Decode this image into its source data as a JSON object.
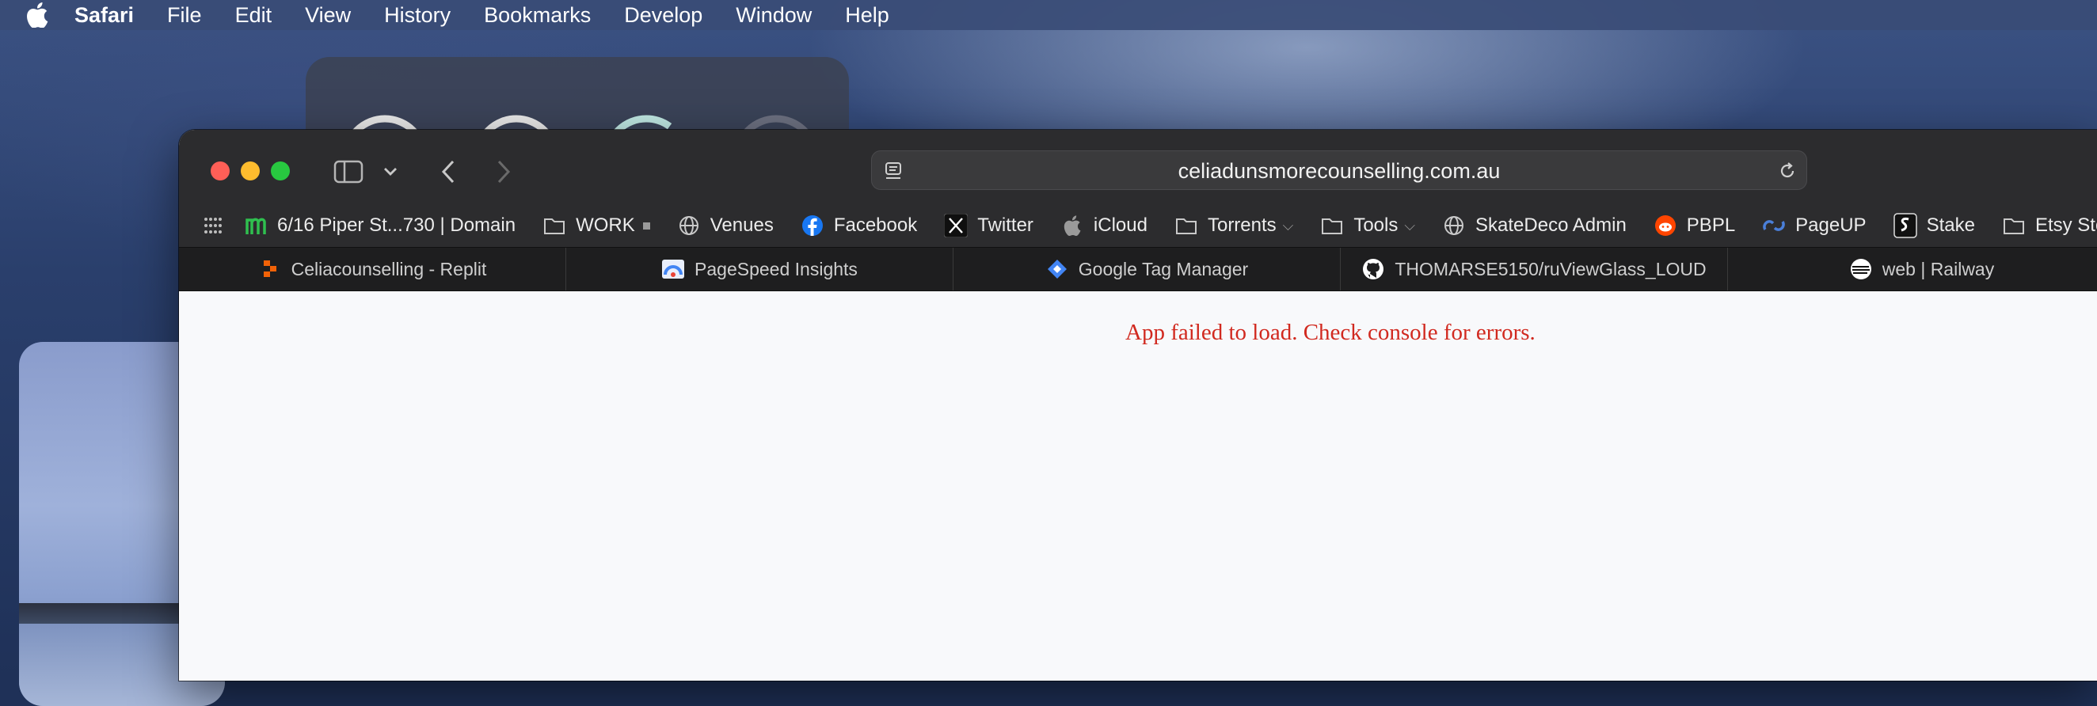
{
  "menubar": {
    "app_name": "Safari",
    "items": [
      "File",
      "Edit",
      "View",
      "History",
      "Bookmarks",
      "Develop",
      "Window",
      "Help"
    ]
  },
  "address_bar": {
    "url": "celiadunsmorecounselling.com.au"
  },
  "bookmarks": [
    {
      "label": "6/16 Piper St...730 | Domain",
      "icon": "domain-icon"
    },
    {
      "label": "WORK",
      "icon": "folder-icon"
    },
    {
      "label": "Venues",
      "icon": "globe-icon"
    },
    {
      "label": "Facebook",
      "icon": "facebook-icon"
    },
    {
      "label": "Twitter",
      "icon": "x-icon"
    },
    {
      "label": "iCloud",
      "icon": "apple-icon"
    },
    {
      "label": "Torrents",
      "icon": "folder-icon"
    },
    {
      "label": "Tools",
      "icon": "folder-icon"
    },
    {
      "label": "SkateDeco Admin",
      "icon": "globe-icon"
    },
    {
      "label": "PBPL",
      "icon": "reddit-icon"
    },
    {
      "label": "PageUP",
      "icon": "pageup-icon"
    },
    {
      "label": "Stake",
      "icon": "stake-icon"
    },
    {
      "label": "Etsy Sto",
      "icon": "folder-icon"
    }
  ],
  "tabs": [
    {
      "label": "Celiacounselling - Replit",
      "icon": "replit-icon"
    },
    {
      "label": "PageSpeed Insights",
      "icon": "pagespeed-icon"
    },
    {
      "label": "Google Tag Manager",
      "icon": "tag-manager-icon"
    },
    {
      "label": "THOMARSE5150/ruViewGlass_LOUD",
      "icon": "github-icon"
    },
    {
      "label": "web | Railway",
      "icon": "railway-icon"
    }
  ],
  "content": {
    "error_message": "App failed to load. Check console for errors."
  },
  "colors": {
    "error_text": "#d1291f",
    "window_chrome": "#2c2c2e",
    "page_background": "#f8f9fb"
  }
}
